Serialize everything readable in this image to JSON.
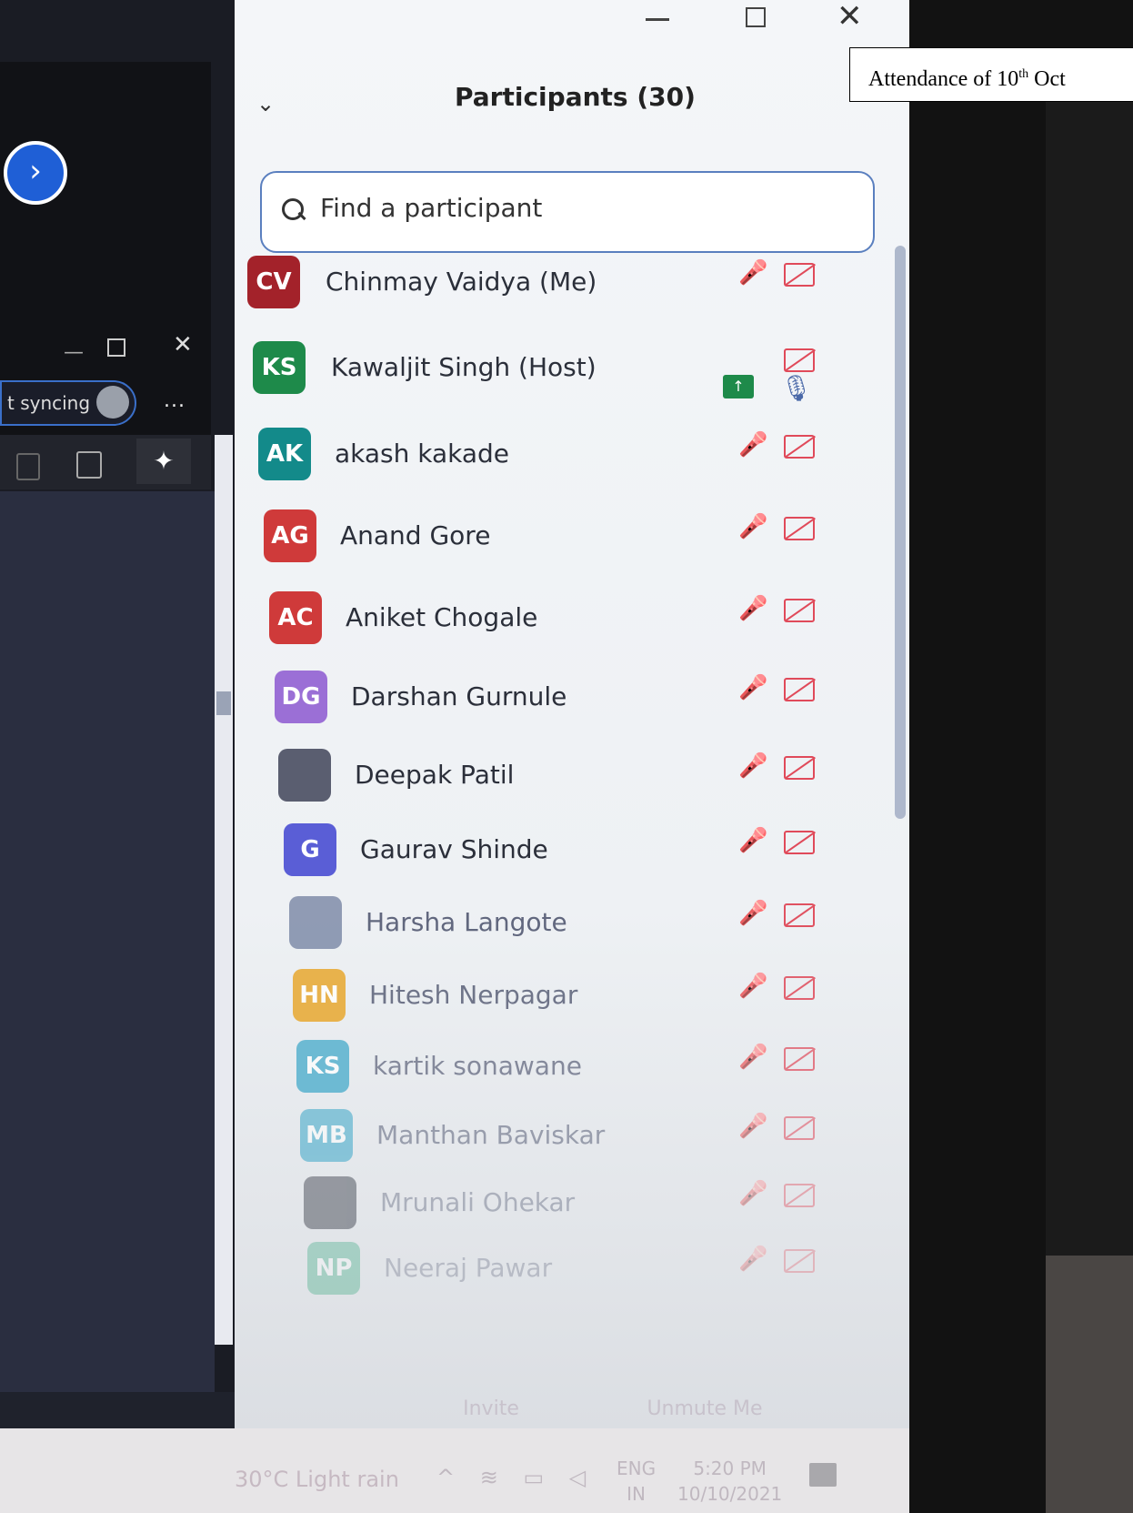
{
  "caption": {
    "prefix": "Attendance of 10",
    "sup": "th",
    "suffix": " Oct"
  },
  "left_app": {
    "sync_label": "t syncing",
    "more_label": "..."
  },
  "panel": {
    "title": "Participants (30)",
    "search": {
      "placeholder": "Find a participant"
    }
  },
  "participants": [
    {
      "initials": "CV",
      "name": "Chinmay Vaidya (Me)",
      "color": "#a3222a"
    },
    {
      "initials": "KS",
      "name": "Kawaljit Singh (Host)",
      "color": "#1e8a4a"
    },
    {
      "initials": "AK",
      "name": "akash kakade",
      "color": "#138a8a"
    },
    {
      "initials": "AG",
      "name": "Anand Gore",
      "color": "#cf3a3a"
    },
    {
      "initials": "AC",
      "name": "Aniket Chogale",
      "color": "#cf3a3a"
    },
    {
      "initials": "DG",
      "name": "Darshan Gurnule",
      "color": "#9b6fd6"
    },
    {
      "initials": "",
      "name": "Deepak Patil",
      "color": "#5a5e70"
    },
    {
      "initials": "G",
      "name": "Gaurav Shinde",
      "color": "#5a5ed6"
    },
    {
      "initials": "",
      "name": "Harsha Langote",
      "color": "#8a96b0"
    },
    {
      "initials": "HN",
      "name": "Hitesh Nerpagar",
      "color": "#e8a830"
    },
    {
      "initials": "KS",
      "name": "kartik sonawane",
      "color": "#3aa6c8"
    },
    {
      "initials": "MB",
      "name": "Manthan Baviskar",
      "color": "#3aa6c8"
    },
    {
      "initials": "",
      "name": "Mrunali Ohekar",
      "color": "#1d2330"
    },
    {
      "initials": "NP",
      "name": "Neeraj Pawar",
      "color": "#1fa070"
    }
  ],
  "host_share_icon": "share-screen-icon",
  "buttons": {
    "invite": "Invite",
    "unmute": "Unmute Me"
  },
  "taskbar": {
    "weather": "30°C  Light rain",
    "lang_top": "ENG",
    "lang_bottom": "IN",
    "time": "5:20 PM",
    "date": "10/10/2021"
  }
}
